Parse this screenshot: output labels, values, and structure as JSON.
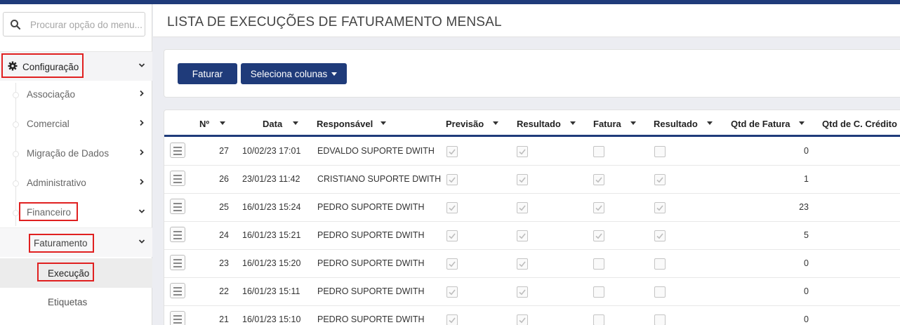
{
  "search": {
    "placeholder": "Procurar opção do menu..."
  },
  "sidebar": {
    "config_label": "Configuração",
    "items": [
      {
        "label": "Associação"
      },
      {
        "label": "Comercial"
      },
      {
        "label": "Migração de Dados"
      },
      {
        "label": "Administrativo"
      },
      {
        "label": "Financeiro"
      }
    ],
    "faturamento_label": "Faturamento",
    "execucao_label": "Execução",
    "etiquetas_label": "Etiquetas"
  },
  "page": {
    "title": "LISTA DE EXECUÇÕES DE FATURAMENTO MENSAL"
  },
  "toolbar": {
    "faturar_label": "Faturar",
    "colunas_label": "Seleciona colunas"
  },
  "table": {
    "headers": [
      "Nº",
      "Data",
      "Responsável",
      "Previsão",
      "Resultado",
      "Fatura",
      "Resultado",
      "Qtd de Fatura",
      "Qtd de C. Crédito"
    ],
    "rows": [
      {
        "num": "27",
        "data": "10/02/23 17:01",
        "resp": "EDVALDO SUPORTE DWITH",
        "prev": true,
        "res1": true,
        "fat": false,
        "res2": false,
        "qtd": "0"
      },
      {
        "num": "26",
        "data": "23/01/23 11:42",
        "resp": "CRISTIANO SUPORTE DWITH",
        "prev": true,
        "res1": true,
        "fat": true,
        "res2": true,
        "qtd": "1"
      },
      {
        "num": "25",
        "data": "16/01/23 15:24",
        "resp": "PEDRO SUPORTE DWITH",
        "prev": true,
        "res1": true,
        "fat": true,
        "res2": true,
        "qtd": "23"
      },
      {
        "num": "24",
        "data": "16/01/23 15:21",
        "resp": "PEDRO SUPORTE DWITH",
        "prev": true,
        "res1": true,
        "fat": true,
        "res2": true,
        "qtd": "5"
      },
      {
        "num": "23",
        "data": "16/01/23 15:20",
        "resp": "PEDRO SUPORTE DWITH",
        "prev": true,
        "res1": true,
        "fat": false,
        "res2": false,
        "qtd": "0"
      },
      {
        "num": "22",
        "data": "16/01/23 15:11",
        "resp": "PEDRO SUPORTE DWITH",
        "prev": true,
        "res1": true,
        "fat": false,
        "res2": false,
        "qtd": "0"
      },
      {
        "num": "21",
        "data": "16/01/23 15:10",
        "resp": "PEDRO SUPORTE DWITH",
        "prev": true,
        "res1": true,
        "fat": false,
        "res2": false,
        "qtd": "0"
      }
    ]
  },
  "colors": {
    "primary": "#1f3b7a",
    "highlight": "#e02020"
  }
}
